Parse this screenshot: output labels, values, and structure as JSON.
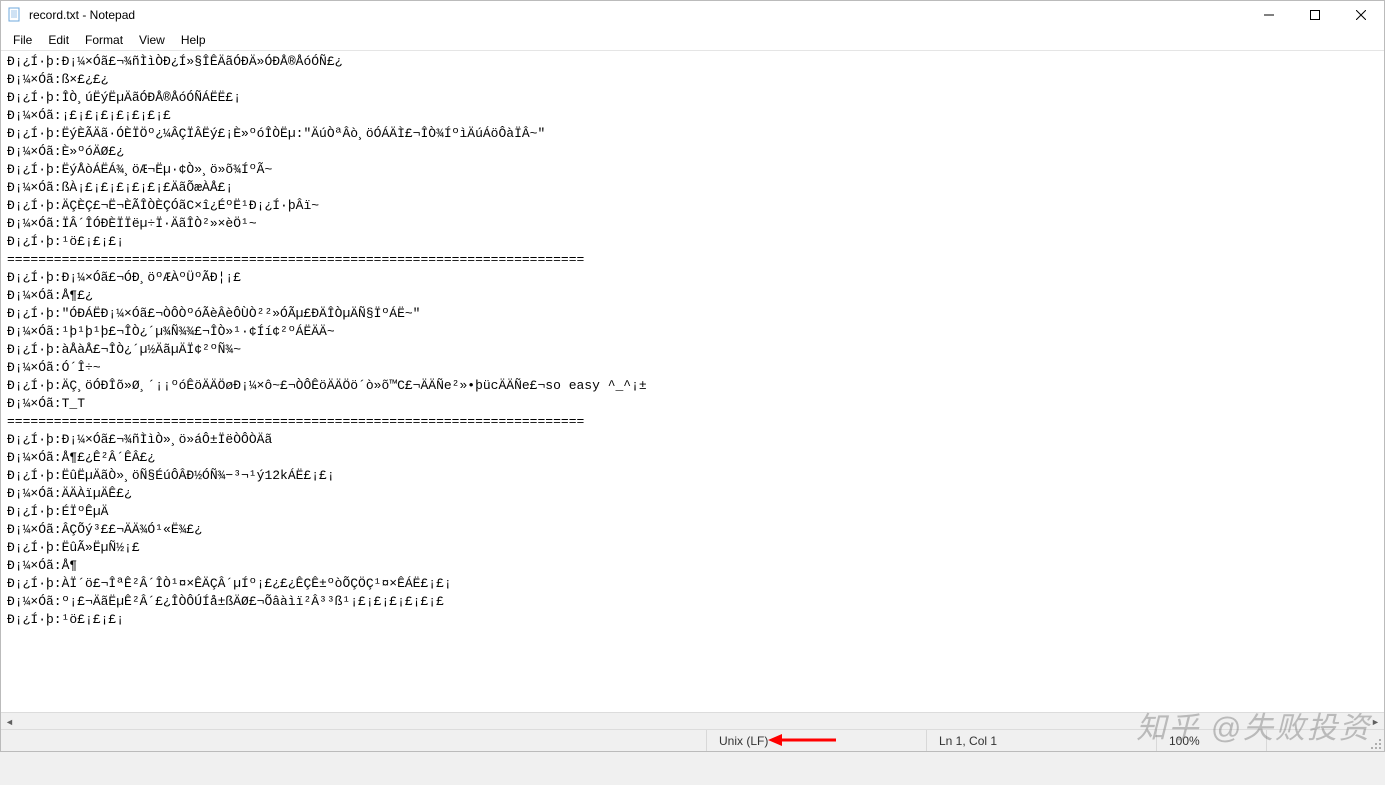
{
  "title": "record.txt - Notepad",
  "menu": {
    "file": "File",
    "edit": "Edit",
    "format": "Format",
    "view": "View",
    "help": "Help"
  },
  "content": "Ð¡¿Í·þ:Ð¡¼×Óã£¬¾ñÌìÒÐ¿Í»§ÎÊÄãÓÐÄ»ÓÐÅ®ÅóÓÑ£¿\nÐ¡¼×Óã:ß×£¿£¿\nÐ¡¿Í·þ:ÎÒ¸úËýËµÄãÓÐÅ®ÅóÓÑÁËË£¡\nÐ¡¼×Óã:¡£¡£¡£¡£¡£¡£¡£\nÐ¡¿Í·þ:ËýÈÃÄã·ÓÈÏÖº¿¼ÂÇÏÂËý£¡È»ºóÎÒËµ:\"ÄúÒªÂò¸öÓÁÄÌ£¬ÎÒ¾ÍºìÄúÁöÔàÏÂ~\"\nÐ¡¼×Óã:È»ºóÄØ£¿\nÐ¡¿Í·þ:ËýÅòÁËÁ¾¸öÆ¬Ëµ·¢Ò»¸ö»õ¾ÍºÃ~\nÐ¡¼×Óã:ßÀ¡£¡£¡£¡£¡£¡£ÄãÕæÀÅ£¡\nÐ¡¿Í·þ:ÄÇÈÇ£¬Ë¬ÈÃÎÒÈÇÓãC×î¿ÉºË¹Ð¡¿Í·þÂï~\nÐ¡¼×Óã:ÏÂ´ÎÓÐÈÏÏëµ÷Ï·ÄãÎÒ²»×èÖ¹~\nÐ¡¿Í·þ:¹ö£¡£¡£¡\n==========================================================================\nÐ¡¿Í·þ:Ð¡¼×Óã£¬ÓÐ¸öºÆÀºÜºÃÐ¦¡£\nÐ¡¼×Óã:Å¶£¿\nÐ¡¿Í·þ:\"ÓÐÁËÐ¡¼×Óã£¬ÒÔÒºóÃèÂèÔÙÒ²²»ÓÃµ£ÐÄÎÒµÄÑ§ÏºÁË~\"\nÐ¡¼×Óã:¹þ¹þ¹þ£¬ÎÒ¿´µ¾Ñ¾¾£¬ÎÒ»¹·¢Íí¢²ºÁËÄÄ~\nÐ¡¿Í·þ:àÅàÅ£¬ÎÒ¿´µ½ÄãµÄÏ¢²ºÑ¾~\nÐ¡¼×Óã:Ó´Î÷~\nÐ¡¿Í·þ:ÄÇ¸öÓÐÎõ»Ø¸´¡¡ºóÊöÄÄÖøÐ¡¼×ô~£¬ÒÔÊöÄÄÖö´ò»õ™C£¬ÄÄÑe²»•þücÄÄÑe£¬so easy ^_^¡±\nÐ¡¼×Óã:T_T\n==========================================================================\nÐ¡¿Í·þ:Ð¡¼×Óã£¬¾ñÌìÒ»¸ö»áÔ±ÏëÒÔÒÄã\nÐ¡¼×Óã:Å¶£¿Ê²Â´ÊÂ£¿\nÐ¡¿Í·þ:ËûËµÄãÒ»¸öÑ§ÉúÔÂÐ½ÓÑ¾−³¬¹ý12kÁË£¡£¡\nÐ¡¼×Óã:ÄÄÀïµÄÊ£¿\nÐ¡¿Í·þ:ÉÏºÊµÄ\nÐ¡¼×Óã:ÂÇÕý³££¬ÄÄ¾Ó¹«Ë¾£¿\nÐ¡¿Í·þ:ËûÃ»ËµÑ½¡£\nÐ¡¼×Óã:Å¶\nÐ¡¿Í·þ:ÀÏ´ö£¬ÎªÊ²Â´ÎÒ¹¤×ÊÄÇÂ´µÍº¡£¿£¿ÊÇÊ±ºòÕÇÖÇ¹¤×ÊÁË£¡£¡\nÐ¡¼×Óã:º¡£¬ÄãËµÊ²Â´£¿ÎÒÔÚÍå±ßÄØ£¬Õâàìï²Â³³ß¹¡£¡£¡£¡£¡£¡£\nÐ¡¿Í·þ:¹ö£¡£¡£¡",
  "status": {
    "line_ending": "Unix (LF)",
    "position": "Ln 1, Col 1",
    "zoom": "100%",
    "encoding": ""
  },
  "watermark": "知乎 @失败投资"
}
